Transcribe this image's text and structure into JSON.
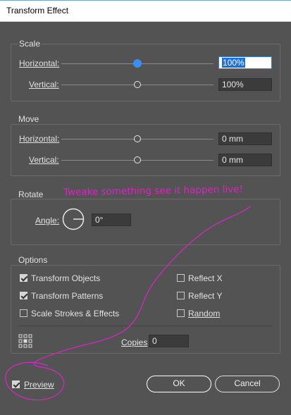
{
  "window": {
    "title": "Transform Effect"
  },
  "scale": {
    "label": "Scale",
    "horizontal": {
      "label": "Horizontal:",
      "value": "100%",
      "slider": 0.5
    },
    "vertical": {
      "label": "Vertical:",
      "value": "100%",
      "slider": 0.5
    }
  },
  "move": {
    "label": "Move",
    "horizontal": {
      "label": "Horizontal:",
      "value": "0 mm",
      "slider": 0.5
    },
    "vertical": {
      "label": "Vertical:",
      "value": "0 mm",
      "slider": 0.5
    }
  },
  "rotate": {
    "label": "Rotate",
    "angle_label": "Angle:",
    "angle_value": "0°"
  },
  "options": {
    "label": "Options",
    "transform_objects": {
      "label": "Transform Objects",
      "checked": true
    },
    "transform_patterns": {
      "label": "Transform Patterns",
      "checked": true
    },
    "scale_strokes": {
      "label": "Scale Strokes & Effects",
      "checked": false
    },
    "reflect_x": {
      "label": "Reflect X",
      "checked": false
    },
    "reflect_y": {
      "label": "Reflect Y",
      "checked": false
    },
    "random": {
      "label": "Random",
      "checked": false
    },
    "copies_label": "Copies",
    "copies_value": "0"
  },
  "preview": {
    "label": "Preview",
    "checked": true
  },
  "buttons": {
    "ok": "OK",
    "cancel": "Cancel"
  },
  "annotation": {
    "text": "Tweake something see it happen live!",
    "color": "#e020c8"
  },
  "colors": {
    "dialog_bg": "#535353",
    "accent": "#3a8ef0"
  }
}
